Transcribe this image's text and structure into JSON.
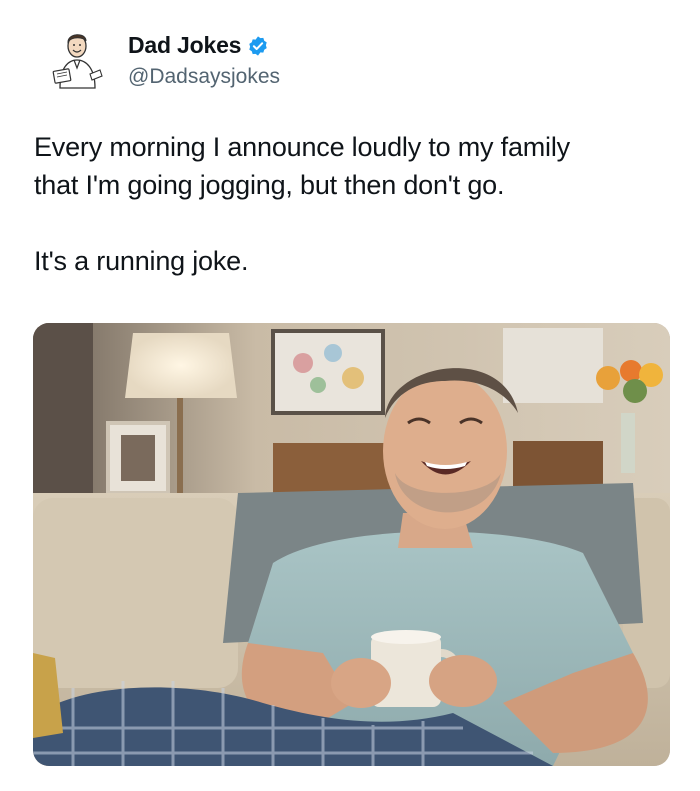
{
  "author": {
    "display_name": "Dad Jokes",
    "handle": "@Dadsaysjokes",
    "avatar_icon": "cartoon-dad-avatar-icon",
    "verified_icon": "verified-badge-icon",
    "verified_color": "#1d9bf0"
  },
  "tweet": {
    "line1": "Every morning I announce loudly to my family",
    "line2": "that I'm going jogging, but then don't go.",
    "punchline": "It's a running joke."
  },
  "media": {
    "icon": "laughing-man-on-couch-photo"
  },
  "colors": {
    "text": "#0f1419",
    "secondary": "#536471",
    "background": "#ffffff"
  }
}
